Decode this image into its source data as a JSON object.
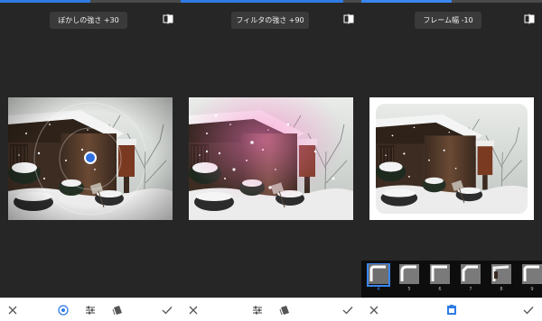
{
  "colors": {
    "accent": "#2f7be5",
    "background": "#262626",
    "bottom_bar": "#ffffff",
    "strip": "#0d0d0d"
  },
  "panels": [
    {
      "label": "ぼかしの強さ +30",
      "progress": 0.5,
      "icons": [
        "compare-icon",
        "close-icon",
        "center-point-icon",
        "tune-icon",
        "style-icon",
        "check-icon"
      ]
    },
    {
      "label": "フィルタの強さ +90",
      "progress": 0.9,
      "icons": [
        "compare-icon",
        "close-icon",
        "tune-icon",
        "style-icon",
        "check-icon"
      ]
    },
    {
      "label": "フレーム幅 -10",
      "progress": 0.5,
      "icons": [
        "compare-icon",
        "close-icon",
        "frame-icon",
        "check-icon"
      ],
      "frames": {
        "numbers": [
          "4",
          "5",
          "6",
          "7",
          "8",
          "9"
        ],
        "selected": "4"
      }
    }
  ]
}
